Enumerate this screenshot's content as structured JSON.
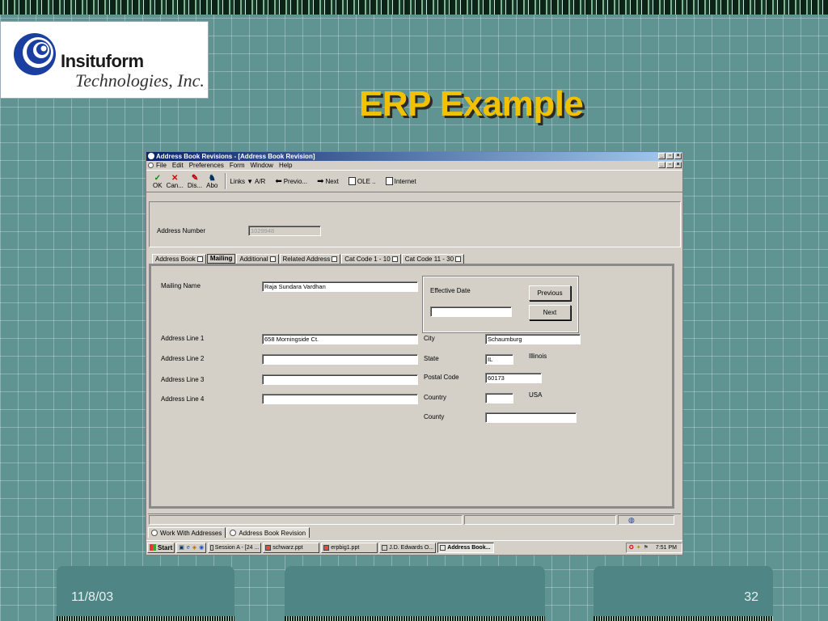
{
  "slide": {
    "title": "ERP Example",
    "date": "11/8/03",
    "page_number": "32",
    "logo": {
      "brand": "Insituform",
      "subtitle": "Technologies, Inc."
    }
  },
  "window": {
    "title": "Address Book Revisions - [Address Book Revision]",
    "menu": [
      "File",
      "Edit",
      "Preferences",
      "Form",
      "Window",
      "Help"
    ],
    "toolbar": {
      "ok": "OK",
      "cancel": "Can...",
      "display": "Dis...",
      "about": "Abo",
      "links": "Links",
      "air": "A/R",
      "previous": "Previo...",
      "next": "Next",
      "ole": "OLE ..",
      "internet": "Internet"
    },
    "header": {
      "address_number_label": "Address Number",
      "address_number_value": "1029948"
    },
    "tabs": [
      "Address Book",
      "Mailing",
      "Additional",
      "Related Address",
      "Cat Code 1 - 10",
      "Cat Code 11 - 30"
    ],
    "active_tab": "Mailing",
    "form": {
      "mailing_name_label": "Mailing Name",
      "mailing_name_value": "Raja Sundara Vardhan",
      "effective_date_label": "Effective Date",
      "effective_date_value": "",
      "previous_button": "Previous",
      "next_button": "Next",
      "address_line_1_label": "Address Line 1",
      "address_line_1_value": "658 Morningside Ct.",
      "address_line_2_label": "Address Line 2",
      "address_line_2_value": "",
      "address_line_3_label": "Address Line 3",
      "address_line_3_value": "",
      "address_line_4_label": "Address Line 4",
      "address_line_4_value": "",
      "city_label": "City",
      "city_value": "Schaumburg",
      "state_label": "State",
      "state_value": "IL",
      "state_description": "Illinois",
      "postal_code_label": "Postal Code",
      "postal_code_value": "60173",
      "country_label": "Country",
      "country_value": "",
      "country_description": "USA",
      "county_label": "County",
      "county_value": ""
    },
    "window_tabs": [
      "Work With Addresses",
      "Address Book Revision"
    ]
  },
  "taskbar": {
    "start": "Start",
    "items": [
      "Session A - [24 ...",
      "schwarz.ppt",
      "erpbig1.ppt",
      "J.D. Edwards O...",
      "Address Book..."
    ],
    "active_item": "Address Book...",
    "clock": "7:51 PM"
  }
}
